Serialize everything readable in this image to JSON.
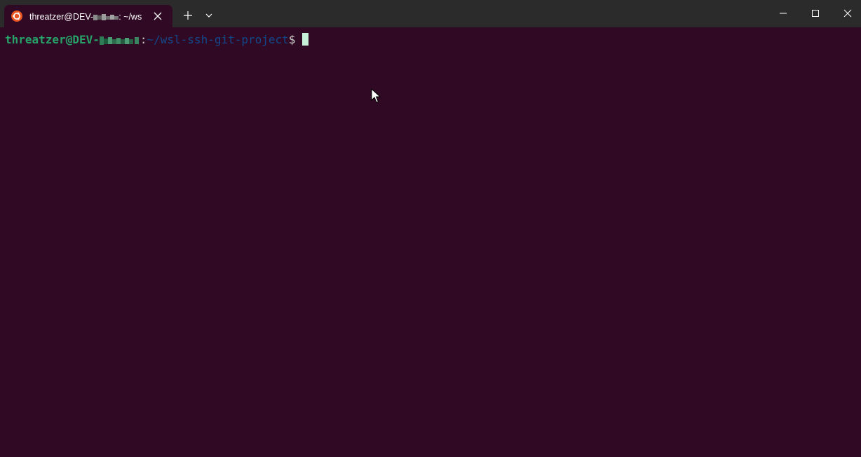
{
  "tab": {
    "title_prefix": "threatzer@DEV-",
    "title_suffix": ": ~/ws",
    "icon": "ubuntu-icon"
  },
  "toolbar": {
    "new_tab_icon": "plus-icon",
    "dropdown_icon": "chevron-down-icon"
  },
  "window_controls": {
    "minimize_icon": "minimize-icon",
    "maximize_icon": "maximize-icon",
    "close_icon": "close-icon"
  },
  "terminal": {
    "user_host_prefix": "threatzer@DEV-",
    "colon": ":",
    "path": "~/wsl-ssh-git-project",
    "dollar": "$"
  },
  "colors": {
    "terminal_background": "#300a24",
    "titlebar_background": "#2b2b2b",
    "prompt_user": "#26a269",
    "prompt_path": "#12488b",
    "cursor": "#c6f0d8",
    "ubuntu_orange": "#e95420"
  }
}
